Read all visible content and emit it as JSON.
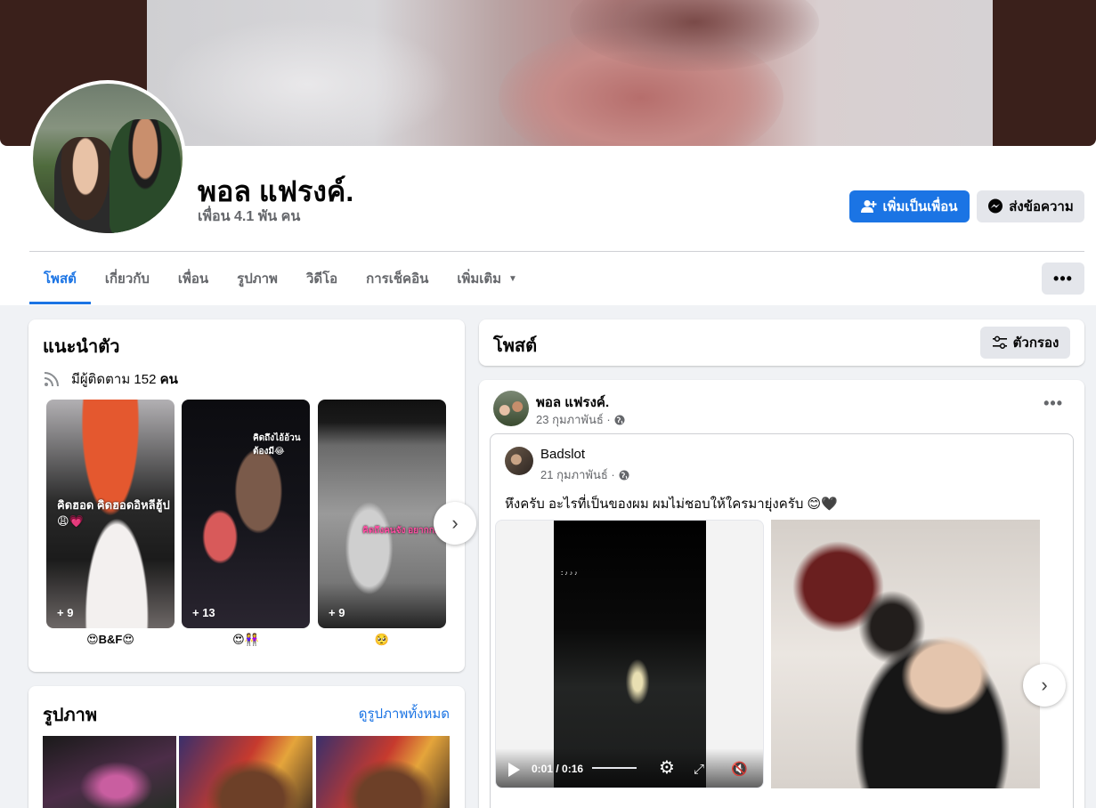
{
  "profile": {
    "name": "พอล แฟรงค์.",
    "friends": "เพื่อน 4.1 พัน คน",
    "add_friend_label": "เพิ่มเป็นเพื่อน",
    "message_label": "ส่งข้อความ"
  },
  "tabs": [
    {
      "label": "โพสต์",
      "active": true
    },
    {
      "label": "เกี่ยวกับ"
    },
    {
      "label": "เพื่อน"
    },
    {
      "label": "รูปภาพ"
    },
    {
      "label": "วิดีโอ"
    },
    {
      "label": "การเช็คอิน"
    },
    {
      "label": "เพิ่มเติม"
    }
  ],
  "intro": {
    "title": "แนะนำตัว",
    "followers_prefix": "มีผู้ติดตาม 152",
    "followers_suffix": "คน",
    "stories": [
      {
        "count": "+ 9",
        "label": "😍B&F😍",
        "text": "คิดฮอด คิดฮอดอิหลีฮู้ป 😩💗"
      },
      {
        "count": "+ 13",
        "label": "😍👭",
        "text": "คิดถึงไอ้อ้วนต้องมี😂"
      },
      {
        "count": "+ 9",
        "label": "🥺",
        "text": "คิดถึงคนจัง อยากกอด"
      }
    ]
  },
  "photos": {
    "title": "รูปภาพ",
    "see_all": "ดูรูปภาพทั้งหมด"
  },
  "posts": {
    "title": "โพสต์",
    "filter_label": "ตัวกรอง"
  },
  "post": {
    "author": "พอล แฟรงค์.",
    "date": "23 กุมภาพันธ์ ·",
    "shared": {
      "author": "Badslot",
      "date": "21 กุมภาพันธ์ ·",
      "text": "หึงครับ อะไรที่เป็นของผม ผมไม่ชอบให้ใครมายุ่งครับ 😊🖤",
      "video_time": "0:01 / 0:16"
    }
  },
  "colors": {
    "accent": "#1b74e4",
    "background": "#f0f2f5",
    "secondary_button": "#e4e6eb",
    "muted_text": "#65676b"
  }
}
